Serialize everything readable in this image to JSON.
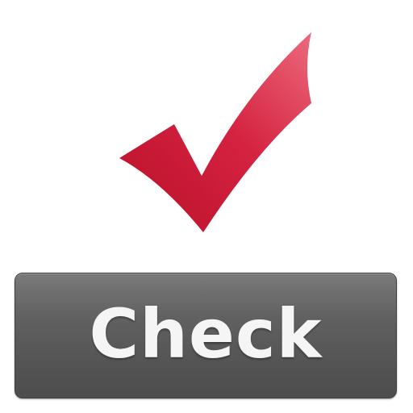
{
  "button": {
    "label": "Check"
  },
  "icon": {
    "name": "checkmark-icon",
    "color": "#d0203a"
  }
}
